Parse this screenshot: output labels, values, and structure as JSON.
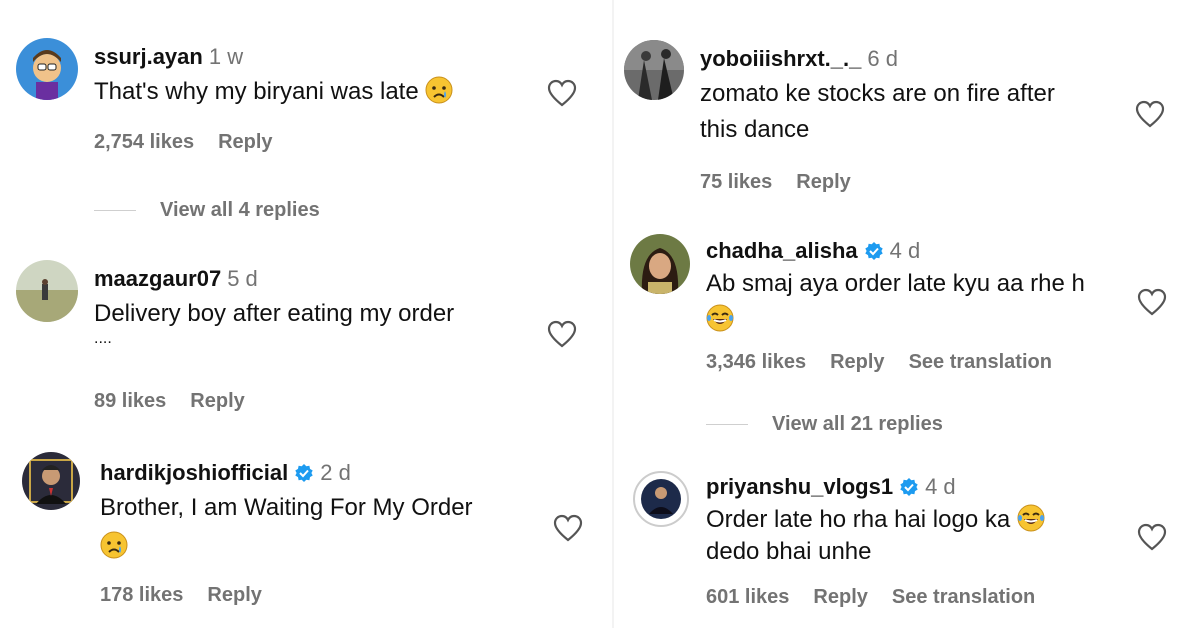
{
  "colors": {
    "username": "#111111",
    "muted": "#737373",
    "verified": "#1d9bf0"
  },
  "left": [
    {
      "username": "ssurj.ayan",
      "time": "1 w",
      "verified": false,
      "text_lines": [
        "That's why my biryani was late"
      ],
      "emoji_after_line": 0,
      "emoji": "crying-face",
      "likes": "2,754 likes",
      "reply": "Reply",
      "view_replies": "View all 4 replies"
    },
    {
      "username": "maazgaur07",
      "time": "5 d",
      "verified": false,
      "text_lines": [
        "Delivery boy after eating my order",
        "...."
      ],
      "likes": "89 likes",
      "reply": "Reply"
    },
    {
      "username": "hardikjoshiofficial",
      "time": "2 d",
      "verified": true,
      "text_lines": [
        "Brother, I am Waiting For My Order"
      ],
      "emoji": "crying-face",
      "likes": "178 likes",
      "reply": "Reply"
    }
  ],
  "right": [
    {
      "username": "yoboiiishrxt._._",
      "time": "6 d",
      "verified": false,
      "text_lines": [
        "zomato ke stocks are on fire after",
        "this dance"
      ],
      "likes": "75 likes",
      "reply": "Reply"
    },
    {
      "username": "chadha_alisha",
      "time": "4 d",
      "verified": true,
      "text_lines": [
        "Ab smaj aya order late kyu aa rhe h"
      ],
      "emoji": "tears-of-joy",
      "likes": "3,346 likes",
      "reply": "Reply",
      "see_translation": "See translation",
      "view_replies": "View all 21 replies"
    },
    {
      "username": "priyanshu_vlogs1",
      "time": "4 d",
      "verified": true,
      "text_lines": [
        "Order late ho rha hai logo ka",
        "dedo bhai unhe"
      ],
      "emoji": "tears-of-joy",
      "likes": "601 likes",
      "reply": "Reply",
      "see_translation": "See translation"
    }
  ]
}
